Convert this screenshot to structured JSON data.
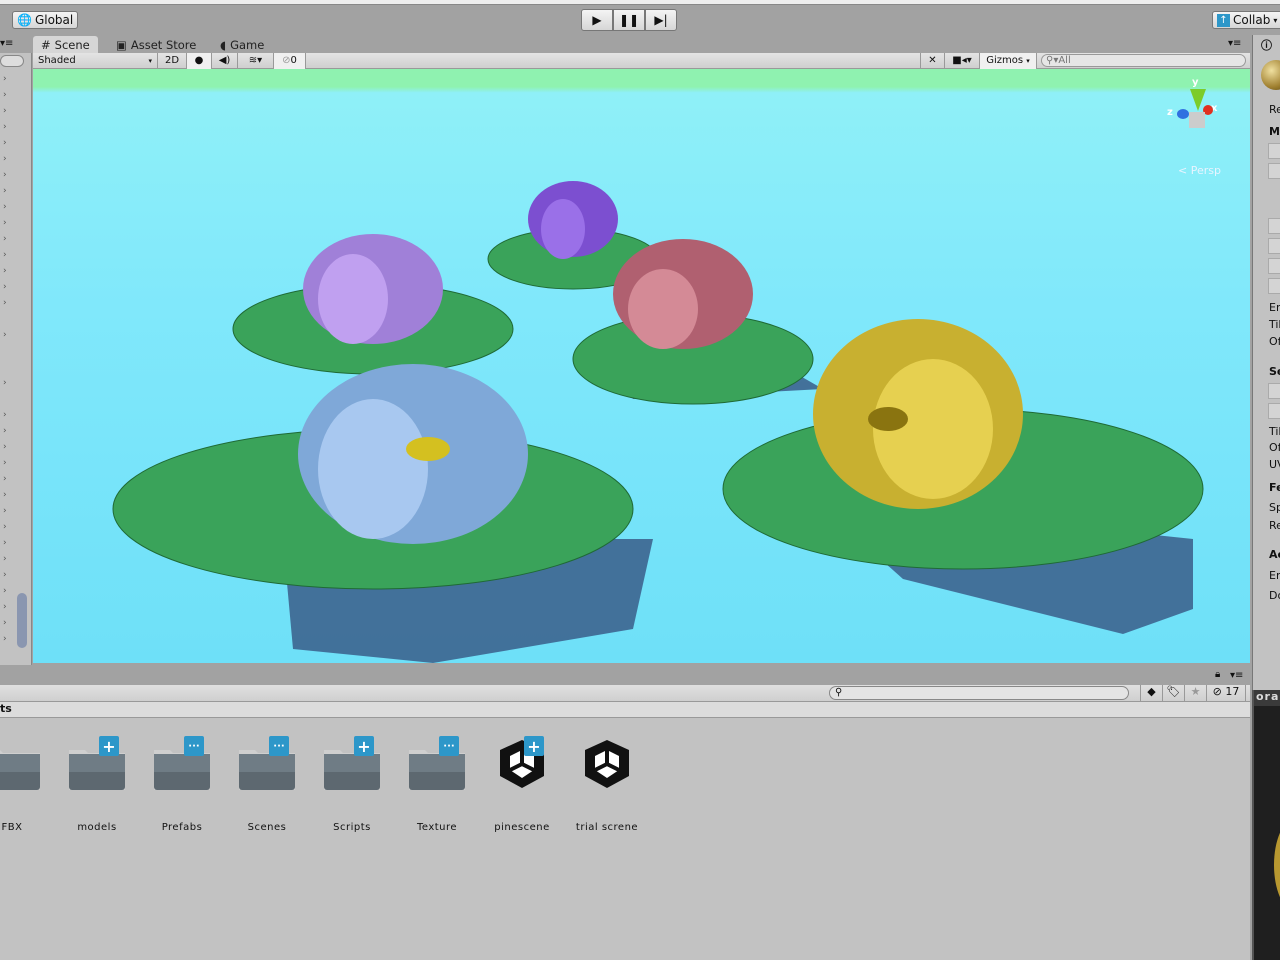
{
  "toolbar": {
    "global_label": "Global",
    "collab_label": "Collab"
  },
  "tabs": [
    {
      "label": "Scene"
    },
    {
      "label": "Asset Store"
    },
    {
      "label": "Game"
    }
  ],
  "scene_toolbar": {
    "shading_mode": "Shaded",
    "mode_2d": "2D",
    "hidden_count": "0",
    "gizmos_label": "Gizmos",
    "search_placeholder": "All",
    "projection_label": "Persp"
  },
  "gizmo_axes": {
    "y": "y",
    "x": "x",
    "z": "z"
  },
  "inspector": {
    "labels": [
      "Re",
      "M",
      "En",
      "Til",
      "Of",
      "Se",
      "Til",
      "Of",
      "UV",
      "Fe",
      "Sp",
      "Re",
      "Ac",
      "En",
      "Do"
    ]
  },
  "project": {
    "breadcrumb": "ts",
    "hidden_count": "17",
    "assets": [
      {
        "name": "FBX",
        "type": "folder",
        "badge": ""
      },
      {
        "name": "models",
        "type": "folder",
        "badge": "+"
      },
      {
        "name": "Prefabs",
        "type": "folder",
        "badge": "..."
      },
      {
        "name": "Scenes",
        "type": "folder",
        "badge": "..."
      },
      {
        "name": "Scripts",
        "type": "folder",
        "badge": "+"
      },
      {
        "name": "Texture",
        "type": "folder",
        "badge": "..."
      },
      {
        "name": "pinescene",
        "type": "scene",
        "badge": "+"
      },
      {
        "name": "trial screne",
        "type": "scene",
        "badge": ""
      }
    ]
  },
  "preview": {
    "label": "ora"
  },
  "colors": {
    "water": "#80e8fb",
    "badge": "#2d97c9",
    "active_tab": "#d6d6d6"
  }
}
